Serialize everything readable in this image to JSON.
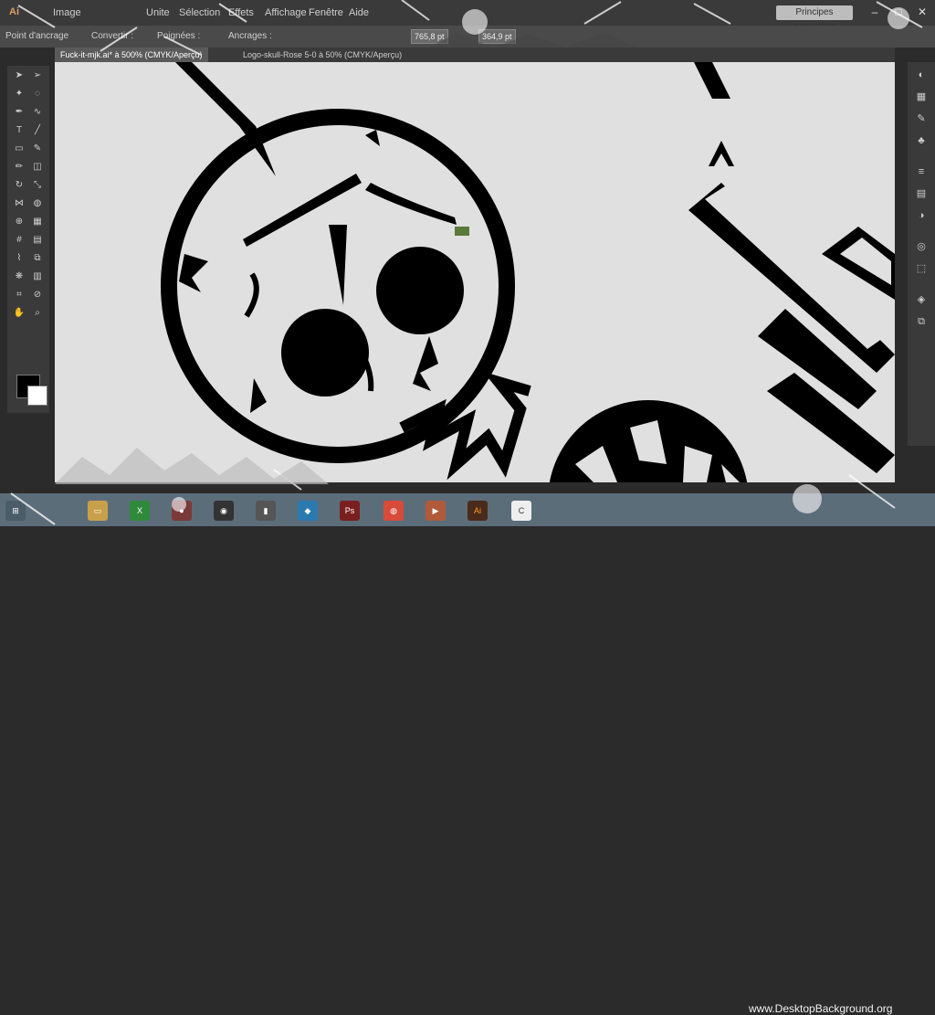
{
  "app": {
    "logo": "Ai"
  },
  "menu": [
    "Image",
    "Unite",
    "Sélection",
    "Effets",
    "Affichage",
    "Fenêtre",
    "Aide"
  ],
  "workspace": {
    "label": "Principes essentiels"
  },
  "control_bar": {
    "object_label": "Point d'ancrage",
    "convert_label": "Convertir :",
    "handles_label": "Poignées :",
    "anchors_label": "Ancrages :",
    "x_value": "765,8 pt",
    "y_value": "364,9 pt"
  },
  "tabs": [
    {
      "label": "Fuck-it-mjk.ai* à 500% (CMYK/Aperçu)"
    },
    {
      "label": "Logo-skull-Rose 5-0 à 50% (CMYK/Aperçu)"
    }
  ],
  "tools": [
    "select-icon",
    "direct-select-icon",
    "magic-wand-icon",
    "lasso-icon",
    "pen-icon",
    "curvature-icon",
    "type-icon",
    "line-icon",
    "rectangle-icon",
    "paintbrush-icon",
    "pencil-icon",
    "eraser-icon",
    "rotate-icon",
    "scale-icon",
    "width-icon",
    "warp-icon",
    "shape-builder-icon",
    "perspective-icon",
    "mesh-icon",
    "gradient-icon",
    "eyedropper-icon",
    "blend-icon",
    "symbol-icon",
    "graph-icon",
    "artboard-icon",
    "slice-icon",
    "hand-icon",
    "zoom-icon"
  ],
  "panel_icons": [
    "color-icon",
    "swatches-icon",
    "brushes-icon",
    "symbols-icon",
    "stroke-icon",
    "gradient-panel-icon",
    "transparency-icon",
    "appearance-icon",
    "graphic-styles-icon",
    "layers-icon",
    "artboards-icon"
  ],
  "taskbar": {
    "apps": [
      "windows-start-icon",
      "file-explorer-icon",
      "excel-icon",
      "media-player-icon",
      "camera-icon",
      "folder-icon",
      "app-icon",
      "photoshop-icon",
      "chrome-icon",
      "video-player-icon",
      "illustrator-icon",
      "c-app-icon"
    ]
  },
  "watermark": "www.DesktopBackground.org",
  "colors": {
    "canvas_bg": "#e0e0e0",
    "artwork": "#000000",
    "ui_dark": "#3a3a3a",
    "taskbar": "#5c6d7a"
  }
}
